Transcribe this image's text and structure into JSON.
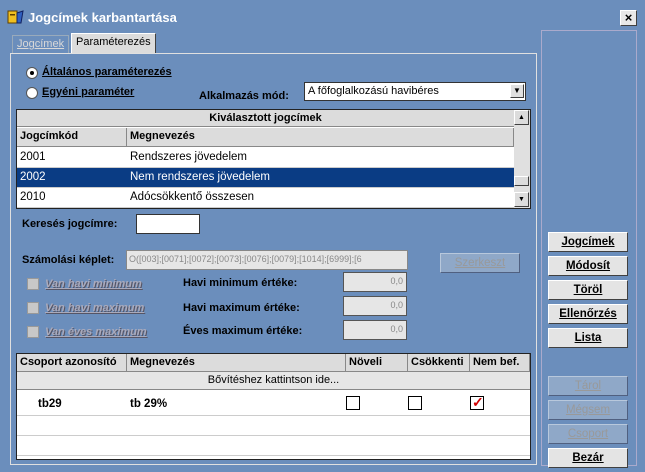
{
  "window": {
    "title": "Jogcímek karbantartása",
    "close_glyph": "×"
  },
  "tabs": [
    {
      "label": "Jogcímek"
    },
    {
      "label": "Paraméterezés"
    }
  ],
  "params": {
    "radio_general": "Általános paraméterezés",
    "radio_individual": "Egyéni paraméter",
    "mode_label": "Alkalmazás mód:",
    "mode_value": "A főfoglalkozású havibéres"
  },
  "selected_grid": {
    "title": "Kiválasztott jogcímek",
    "columns": [
      "Jogcímkód",
      "Megnevezés"
    ],
    "rows": [
      {
        "code": "2001",
        "name": "Rendszeres jövedelem"
      },
      {
        "code": "2002",
        "name": "Nem rendszeres jövedelem"
      },
      {
        "code": "2010",
        "name": "Adócsökkentő összesen"
      }
    ]
  },
  "search": {
    "label": "Keresés jogcímre:",
    "value": ""
  },
  "formula": {
    "label": "Számolási képlet:",
    "value": "O([003];[0071];[0072];[0073];[0076];[0079];[1014];[6999];[6",
    "edit_button": "Szerkeszt"
  },
  "limits": {
    "chk_monthly_min": "Van havi minimum",
    "chk_monthly_max": "Van havi maximum",
    "chk_yearly_max": "Van éves maximum",
    "lbl_monthly_min": "Havi minimum értéke:",
    "lbl_monthly_max": "Havi maximum értéke:",
    "lbl_yearly_max": "Éves maximum értéke:",
    "val_monthly_min": "0,0",
    "val_monthly_max": "0,0",
    "val_yearly_max": "0,0"
  },
  "group_grid": {
    "columns": [
      "Csoport azonosító",
      "Megnevezés",
      "Növeli",
      "Csökkenti",
      "Nem bef."
    ],
    "hint": "Bővítéshez kattintson ide...",
    "rows": [
      {
        "id": "tb29",
        "name": "tb 29%",
        "increases": false,
        "decreases": false,
        "not_affected": true
      }
    ]
  },
  "side_buttons": {
    "jogcimek": "Jogcímek",
    "modosit": "Módosít",
    "torol": "Töröl",
    "ellenorzes": "Ellenőrzés",
    "lista": "Lista",
    "tarol": "Tárol",
    "megsem": "Mégsem",
    "csoport": "Csoport",
    "bezar": "Bezár"
  }
}
